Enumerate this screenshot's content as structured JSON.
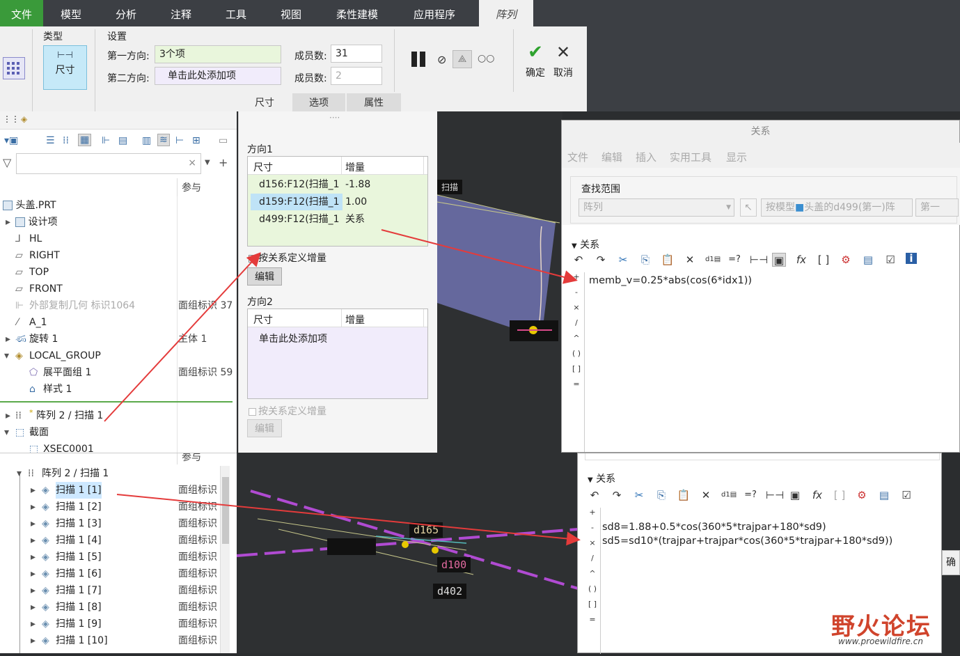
{
  "tabs": [
    "文件",
    "模型",
    "分析",
    "注释",
    "工具",
    "视图",
    "柔性建模",
    "应用程序",
    "阵列"
  ],
  "ribbon": {
    "type_group": "类型",
    "type_button": "尺寸",
    "settings_group": "设置",
    "dir1_label": "第一方向:",
    "dir1_value": "3个项",
    "dir2_label": "第二方向:",
    "dir2_value": "单击此处添加项",
    "count1_label": "成员数:",
    "count1_value": "31",
    "count2_label": "成员数:",
    "count2_value": "2",
    "ok": "确定",
    "cancel": "取消",
    "subtabs": [
      "尺寸",
      "选项",
      "属性"
    ]
  },
  "tree": {
    "col_header": "参与",
    "rows": [
      {
        "label": "头盖.PRT",
        "col2": ""
      },
      {
        "label": "设计项",
        "col2": ""
      },
      {
        "label": "HL",
        "col2": ""
      },
      {
        "label": "RIGHT",
        "col2": ""
      },
      {
        "label": "TOP",
        "col2": ""
      },
      {
        "label": "FRONT",
        "col2": ""
      },
      {
        "label": "外部复制几何 标识1064",
        "col2": "面组标识 37"
      },
      {
        "label": "A_1",
        "col2": ""
      },
      {
        "label": "旋转 1",
        "col2": "主体 1"
      },
      {
        "label": "LOCAL_GROUP",
        "col2": ""
      },
      {
        "label": "展平面组 1",
        "col2": "面组标识 59"
      },
      {
        "label": "样式 1",
        "col2": ""
      },
      {
        "label": "阵列 2 / 扫描 1",
        "col2": ""
      },
      {
        "label": "截面",
        "col2": ""
      },
      {
        "label": "XSEC0001",
        "col2": ""
      }
    ]
  },
  "tree2": {
    "col_header": "参与",
    "parent": "阵列 2 / 扫描 1",
    "items": [
      {
        "label": "扫描 1 [1]",
        "col2": "面组标识"
      },
      {
        "label": "扫描 1 [2]",
        "col2": "面组标识"
      },
      {
        "label": "扫描 1 [3]",
        "col2": "面组标识"
      },
      {
        "label": "扫描 1 [4]",
        "col2": "面组标识"
      },
      {
        "label": "扫描 1 [5]",
        "col2": "面组标识"
      },
      {
        "label": "扫描 1 [6]",
        "col2": "面组标识"
      },
      {
        "label": "扫描 1 [7]",
        "col2": "面组标识"
      },
      {
        "label": "扫描 1 [8]",
        "col2": "面组标识"
      },
      {
        "label": "扫描 1 [9]",
        "col2": "面组标识"
      },
      {
        "label": "扫描 1 [10]",
        "col2": "面组标识"
      }
    ]
  },
  "mid": {
    "dir1": "方向1",
    "col_dim": "尺寸",
    "col_inc": "增量",
    "rows": [
      {
        "dim": "d156:F12(扫描_1",
        "inc": "-1.88"
      },
      {
        "dim": "d159:F12(扫描_1",
        "inc": "1.00"
      },
      {
        "dim": "d499:F12(扫描_1",
        "inc": "关系"
      }
    ],
    "by_relation1": "按关系定义增量",
    "edit1": "编辑",
    "dir2": "方向2",
    "add_item": "单击此处添加项",
    "by_relation2": "按关系定义增量",
    "edit2": "编辑"
  },
  "rel1": {
    "title": "关系",
    "menus": [
      "文件",
      "编辑",
      "插入",
      "实用工具",
      "显示"
    ],
    "scope_label": "查找范围",
    "scope_value": "阵列",
    "model_value": "按模型",
    "model_detail": "头盖的d499(第一)阵",
    "first": "第一",
    "section": "关系",
    "code": "memb_v=0.25*abs(cos(6*idx1))"
  },
  "rel2": {
    "section": "关系",
    "line1": "sd8=1.88+0.5*cos(360*5*trajpar+180*sd9)",
    "line2": "sd5=sd10*(trajpar+trajpar*cos(360*5*trajpar+180*sd9))",
    "edge_char": "确"
  },
  "canvas": {
    "label_sweep": "扫描",
    "d402": "d402",
    "d165": "d165",
    "d100": "d100"
  },
  "watermark": {
    "title": "野火论坛",
    "url": "www.proewildfire.cn"
  }
}
